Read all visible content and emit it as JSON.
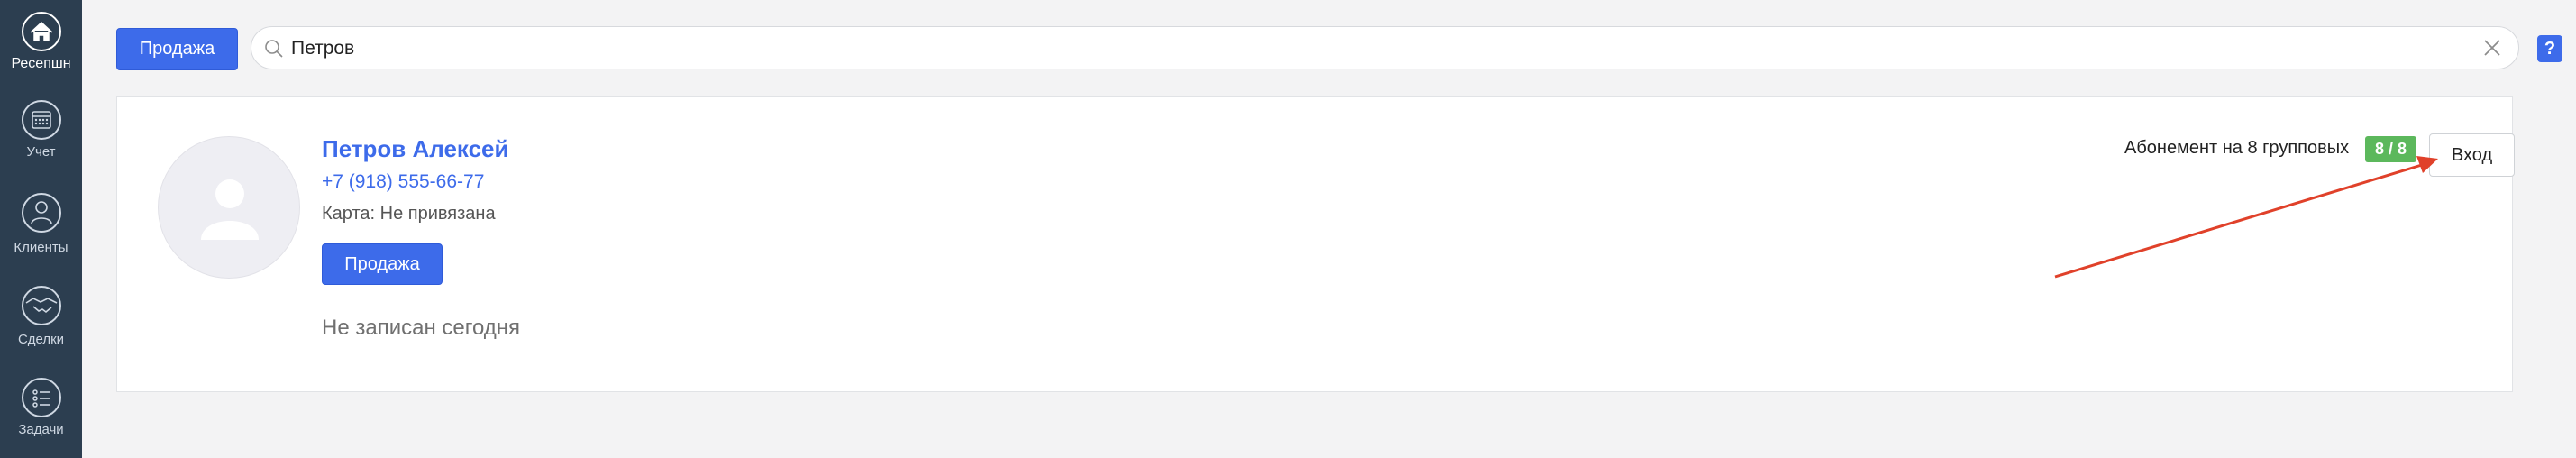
{
  "sidebar": {
    "items": [
      {
        "label": "Ресепшн",
        "icon": "home-icon"
      },
      {
        "label": "Учет",
        "icon": "calendar-icon"
      },
      {
        "label": "Клиенты",
        "icon": "person-icon"
      },
      {
        "label": "Сделки",
        "icon": "handshake-icon"
      },
      {
        "label": "Задачи",
        "icon": "tasks-icon"
      }
    ]
  },
  "topbar": {
    "sale_label": "Продажа",
    "search_value": "Петров",
    "help_label": "?"
  },
  "client": {
    "name": "Петров Алексей",
    "phone": "+7 (918) 555-66-77",
    "card_line": "Карта: Не привязана",
    "sale_label": "Продажа",
    "status": "Не записан сегодня",
    "subscription": "Абонемент на 8 групповых",
    "visits_badge": "8 / 8",
    "enter_label": "Вход"
  },
  "colors": {
    "sidebar_bg": "#2c3e50",
    "accent": "#3d6bea",
    "badge_green": "#5cb85c",
    "annotation_arrow": "#e0412a"
  }
}
